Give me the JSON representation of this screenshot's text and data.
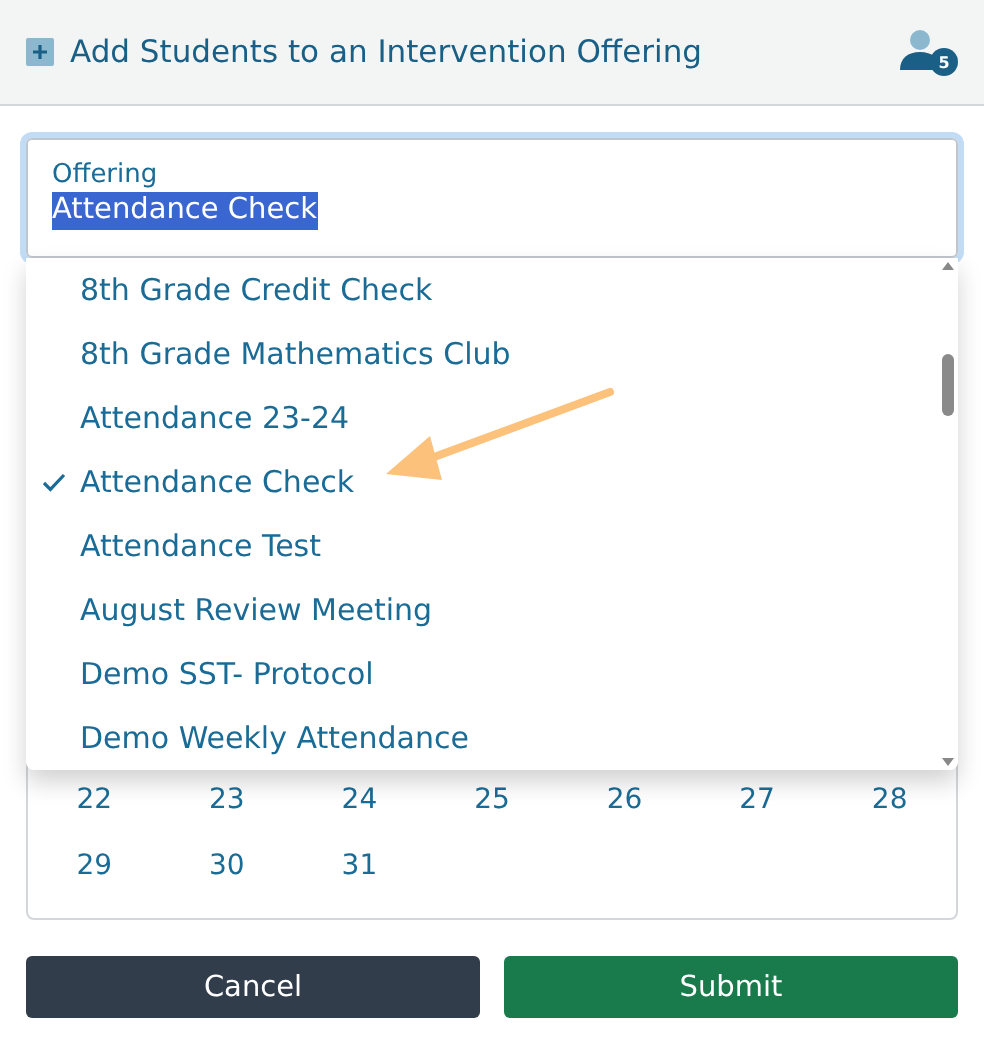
{
  "header": {
    "title": "Add Students to an Intervention Offering",
    "student_count": "5"
  },
  "offering": {
    "label": "Offering",
    "value": "Attendance Check"
  },
  "options": [
    {
      "label": "8th Grade Credit Check",
      "selected": false
    },
    {
      "label": "8th Grade Mathematics Club",
      "selected": false
    },
    {
      "label": "Attendance 23-24",
      "selected": false
    },
    {
      "label": "Attendance Check",
      "selected": true
    },
    {
      "label": "Attendance Test",
      "selected": false
    },
    {
      "label": "August Review Meeting",
      "selected": false
    },
    {
      "label": "Demo SST- Protocol",
      "selected": false
    },
    {
      "label": "Demo Weekly Attendance",
      "selected": false
    }
  ],
  "calendar": {
    "weeks": [
      [
        "22",
        "23",
        "24",
        "25",
        "26",
        "27",
        "28"
      ],
      [
        "29",
        "30",
        "31"
      ]
    ]
  },
  "buttons": [
    {
      "label": "Cancel",
      "kind": "secondary"
    },
    {
      "label": "Submit",
      "kind": "primary"
    }
  ]
}
